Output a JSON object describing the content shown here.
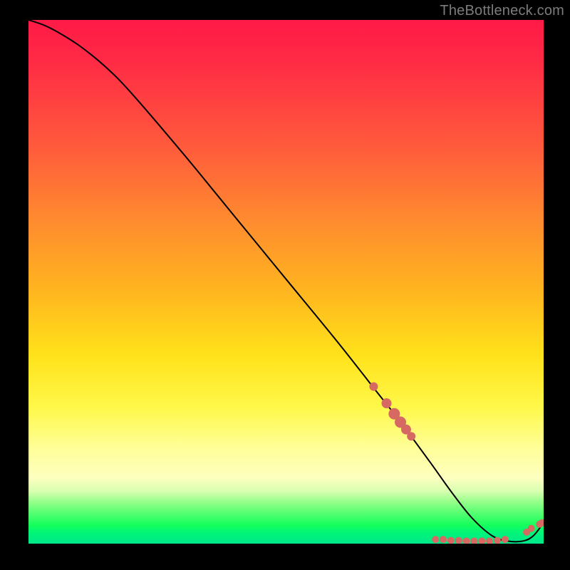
{
  "attribution": "TheBottleneck.com",
  "chart_data": {
    "type": "line",
    "title": "",
    "xlabel": "",
    "ylabel": "",
    "xlim": [
      0,
      100
    ],
    "ylim": [
      0,
      100
    ],
    "curve": {
      "name": "bottleneck-curve",
      "x": [
        0,
        3,
        6,
        10,
        15,
        20,
        30,
        40,
        50,
        60,
        68,
        72,
        78,
        82,
        86,
        90,
        93,
        96,
        98,
        100
      ],
      "values": [
        100,
        99,
        97.5,
        95,
        91,
        86,
        74.5,
        62.5,
        50.5,
        38.5,
        28.5,
        23.5,
        15.5,
        10,
        5,
        1.5,
        0.5,
        0.5,
        1.5,
        4
      ]
    },
    "markers": {
      "name": "highlighted-points",
      "color": "#d66a63",
      "points": [
        {
          "x": 67.0,
          "y": 30.0,
          "r": 6
        },
        {
          "x": 69.5,
          "y": 26.8,
          "r": 7
        },
        {
          "x": 71.0,
          "y": 24.8,
          "r": 8
        },
        {
          "x": 72.2,
          "y": 23.2,
          "r": 8
        },
        {
          "x": 73.3,
          "y": 21.8,
          "r": 7
        },
        {
          "x": 74.3,
          "y": 20.5,
          "r": 6
        },
        {
          "x": 79.0,
          "y": 0.8,
          "r": 5
        },
        {
          "x": 80.5,
          "y": 0.8,
          "r": 5
        },
        {
          "x": 82.0,
          "y": 0.6,
          "r": 5
        },
        {
          "x": 83.5,
          "y": 0.6,
          "r": 5
        },
        {
          "x": 85.0,
          "y": 0.5,
          "r": 5
        },
        {
          "x": 86.5,
          "y": 0.5,
          "r": 5
        },
        {
          "x": 88.0,
          "y": 0.5,
          "r": 5
        },
        {
          "x": 89.5,
          "y": 0.5,
          "r": 5
        },
        {
          "x": 91.0,
          "y": 0.6,
          "r": 5
        },
        {
          "x": 92.5,
          "y": 0.8,
          "r": 5
        },
        {
          "x": 96.7,
          "y": 2.2,
          "r": 5
        },
        {
          "x": 97.6,
          "y": 2.9,
          "r": 5
        },
        {
          "x": 99.2,
          "y": 3.7,
          "r": 5
        },
        {
          "x": 99.7,
          "y": 4.0,
          "r": 5
        }
      ]
    }
  }
}
